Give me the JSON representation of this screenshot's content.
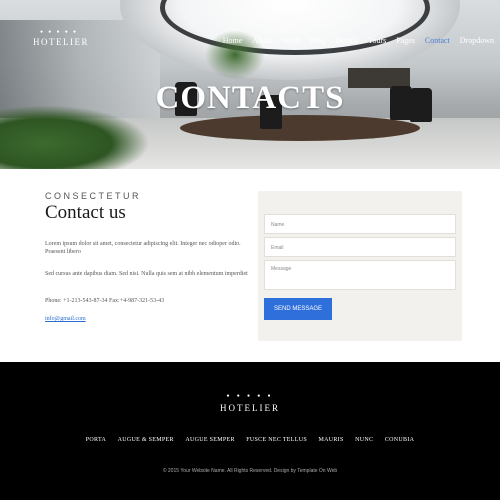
{
  "header": {
    "logo_stars": "● ● ● ● ●",
    "logo_name": "HOTELIER",
    "nav": [
      "Home",
      "About",
      "Work",
      "Blog",
      "Details",
      "Tours",
      "Pages",
      "Contact",
      "Dropdown"
    ],
    "active_nav": "Contact"
  },
  "hero": {
    "title": "CONTACTS"
  },
  "contact": {
    "eyebrow": "CONSECTETUR",
    "heading": "Contact us",
    "para1": "Lorem ipsum dolor sit amet, consectetur adipiscing elit. Integer nec odioper odio. Praesent libero",
    "para2": "Sed cursus ante dapibus diam. Sed nisi. Nulla quis sem at nibh elementum imperdiet",
    "phone": "Phone: +1-213-543-87-34 Fax:+4-987-321-53-43",
    "email": "info@gmail.com"
  },
  "form": {
    "name_placeholder": "Name",
    "email_placeholder": "Email",
    "message_placeholder": "Message",
    "send_label": "SEND MESSAGE"
  },
  "footer": {
    "logo_stars": "● ● ● ● ●",
    "logo_name": "HOTELIER",
    "links": [
      "PORTA",
      "AUGUE & SEMPER",
      "AUGUE SEMPER",
      "FUSCE NEC TELLUS",
      "MAURIS",
      "NUNC",
      "CONUBIA"
    ],
    "copyright": "© 2015 Your Website Name. All Rights Reserved. Design by Template On Web"
  },
  "colors": {
    "accent": "#2f6fdb",
    "footer_bg": "#000000",
    "form_bg": "#f3f1ed"
  }
}
